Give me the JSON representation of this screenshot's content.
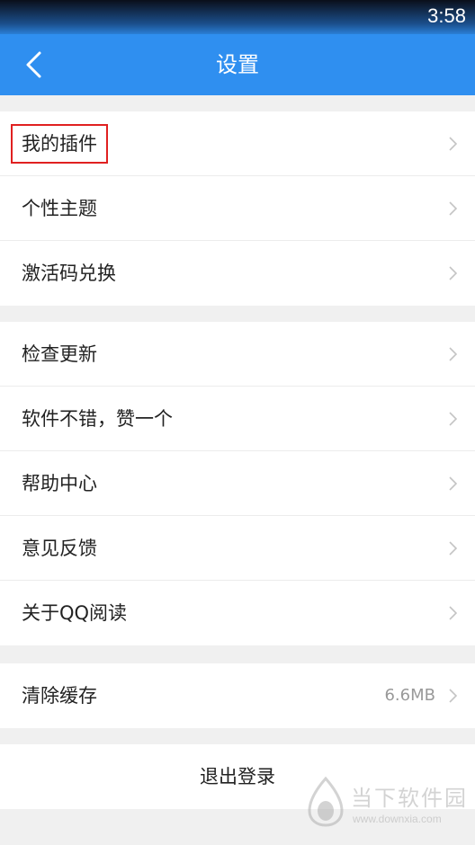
{
  "status_bar": {
    "time": "3:58"
  },
  "header": {
    "title": "设置",
    "back_icon": "chevron-left-icon"
  },
  "groups": [
    {
      "items": [
        {
          "label": "我的插件",
          "highlighted": true
        },
        {
          "label": "个性主题"
        },
        {
          "label": "激活码兑换"
        }
      ]
    },
    {
      "items": [
        {
          "label": "检查更新"
        },
        {
          "label": "软件不错，赞一个"
        },
        {
          "label": "帮助中心"
        },
        {
          "label": "意见反馈"
        },
        {
          "label": "关于QQ阅读"
        }
      ]
    },
    {
      "items": [
        {
          "label": "清除缓存",
          "value": "6.6MB"
        }
      ]
    }
  ],
  "logout": {
    "label": "退出登录"
  },
  "watermark": {
    "name": "当下软件园",
    "url": "www.downxia.com"
  },
  "colors": {
    "app_bar": "#2f8ff0",
    "highlight_border": "#e02020",
    "background": "#f0f0f0"
  }
}
